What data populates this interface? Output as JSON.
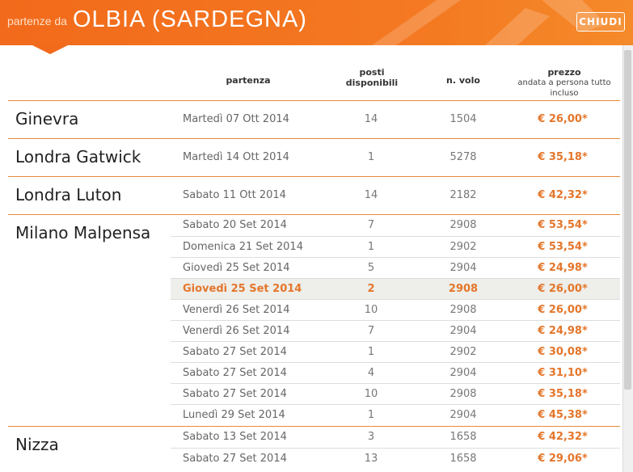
{
  "header": {
    "prefix": "partenze da",
    "city": "OLBIA (SARDEGNA)",
    "close_label": "CHIUDI",
    "accent": "#f26a1b"
  },
  "columns": {
    "departure": "partenza",
    "seats_line1": "posti",
    "seats_line2": "disponibili",
    "flight": "n. volo",
    "price": "prezzo",
    "price_sub": "andata a persona tutto incluso"
  },
  "groups": [
    {
      "destination": "Ginevra",
      "flights": [
        {
          "date": "Martedì 07 Ott 2014",
          "seats": "14",
          "flight": "1504",
          "price": "€ 26,00*"
        }
      ]
    },
    {
      "destination": "Londra Gatwick",
      "flights": [
        {
          "date": "Martedì 14 Ott 2014",
          "seats": "1",
          "flight": "5278",
          "price": "€ 35,18*"
        }
      ]
    },
    {
      "destination": "Londra Luton",
      "flights": [
        {
          "date": "Sabato 11 Ott 2014",
          "seats": "14",
          "flight": "2182",
          "price": "€ 42,32*"
        }
      ]
    },
    {
      "destination": "Milano Malpensa",
      "flights": [
        {
          "date": "Sabato 20 Set 2014",
          "seats": "7",
          "flight": "2908",
          "price": "€ 53,54*"
        },
        {
          "date": "Domenica 21 Set 2014",
          "seats": "1",
          "flight": "2902",
          "price": "€ 53,54*"
        },
        {
          "date": "Giovedì 25 Set 2014",
          "seats": "5",
          "flight": "2904",
          "price": "€ 24,98*"
        },
        {
          "date": "Giovedì 25 Set 2014",
          "seats": "2",
          "flight": "2908",
          "price": "€ 26,00*",
          "highlighted": true
        },
        {
          "date": "Venerdì 26 Set 2014",
          "seats": "10",
          "flight": "2908",
          "price": "€ 26,00*"
        },
        {
          "date": "Venerdì 26 Set 2014",
          "seats": "7",
          "flight": "2904",
          "price": "€ 24,98*"
        },
        {
          "date": "Sabato 27 Set 2014",
          "seats": "1",
          "flight": "2902",
          "price": "€ 30,08*"
        },
        {
          "date": "Sabato 27 Set 2014",
          "seats": "4",
          "flight": "2904",
          "price": "€ 31,10*"
        },
        {
          "date": "Sabato 27 Set 2014",
          "seats": "10",
          "flight": "2908",
          "price": "€ 35,18*"
        },
        {
          "date": "Lunedì 29 Set 2014",
          "seats": "1",
          "flight": "2904",
          "price": "€ 45,38*"
        }
      ]
    },
    {
      "destination": "Nizza",
      "flights": [
        {
          "date": "Sabato 13 Set 2014",
          "seats": "3",
          "flight": "1658",
          "price": "€ 42,32*"
        },
        {
          "date": "Sabato 27 Set 2014",
          "seats": "13",
          "flight": "1658",
          "price": "€ 29,06*"
        }
      ]
    }
  ]
}
